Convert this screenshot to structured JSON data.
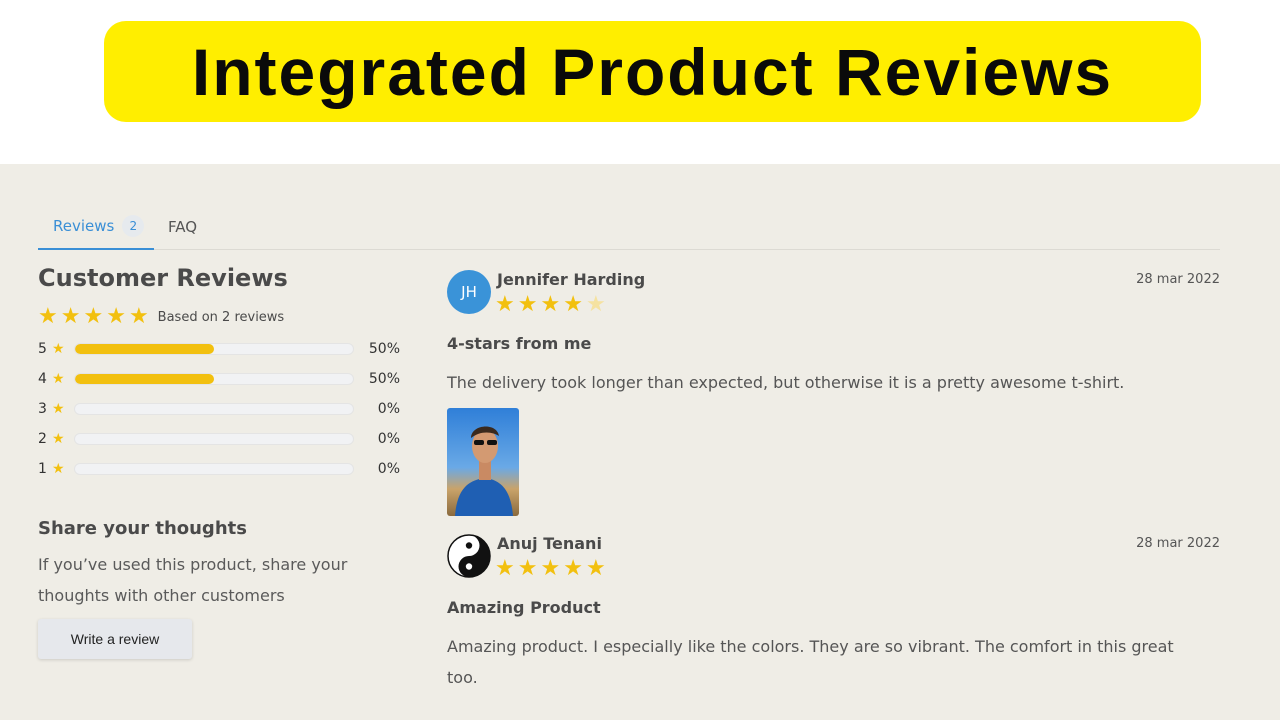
{
  "banner": {
    "title": "Integrated Product Reviews"
  },
  "tabs": [
    {
      "label": "Reviews",
      "count": "2"
    },
    {
      "label": "FAQ"
    }
  ],
  "summary": {
    "heading": "Customer Reviews",
    "rating": 5,
    "based_on": "Based on 2 reviews",
    "distribution": [
      {
        "stars": "5",
        "fraction": 0.5,
        "percent": "50%"
      },
      {
        "stars": "4",
        "fraction": 0.5,
        "percent": "50%"
      },
      {
        "stars": "3",
        "fraction": 0,
        "percent": "0%"
      },
      {
        "stars": "2",
        "fraction": 0,
        "percent": "0%"
      },
      {
        "stars": "1",
        "fraction": 0,
        "percent": "0%"
      }
    ]
  },
  "share": {
    "heading": "Share your thoughts",
    "text": "If you’ve used this product, share your thoughts with other customers",
    "button_label": "Write a review"
  },
  "reviews": [
    {
      "initials": "JH",
      "name": "Jennifer Harding",
      "rating": 4,
      "date": "28 mar 2022",
      "title": "4-stars from me",
      "body": "The delivery took longer than expected, but otherwise it is a pretty awesome t-shirt."
    },
    {
      "avatar_icon": "yin-yang-icon",
      "name": "Anuj Tenani",
      "rating": 5,
      "date": "28 mar 2022",
      "title": "Amazing Product",
      "body": "Amazing product. I especially like the colors. They are so vibrant. The comfort in this great too."
    }
  ],
  "colors": {
    "star": "#f2c00f",
    "accent": "#3a8fd6",
    "banner": "#ffee00",
    "panel": "#efede6"
  }
}
